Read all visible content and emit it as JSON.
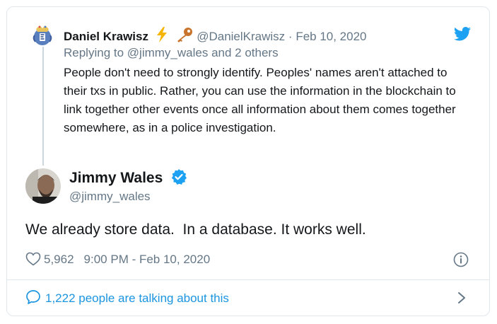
{
  "reply_tweet": {
    "author_name": "Daniel Krawisz",
    "emoji_1": "lightning-emoji",
    "emoji_2": "key-emoji",
    "handle": "@DanielKrawisz",
    "separator": "·",
    "date": "Feb 10, 2020",
    "replying_prefix": "Replying to ",
    "replying_user": "@jimmy_wales",
    "replying_suffix": " and 2 others",
    "text": "People don't need to strongly identify. Peoples' names aren't attached to their txs in public. Rather, you can use the information in the blockchain to link together other events once all information about them comes together somewhere, as in a police investigation."
  },
  "main_tweet": {
    "author_name": "Jimmy Wales",
    "handle": "@jimmy_wales",
    "text": "We already store data.  In a database. It works well.",
    "likes": "5,962",
    "timestamp": "9:00 PM - Feb 10, 2020"
  },
  "footer": {
    "talking_label": "1,222 people are talking about this"
  },
  "colors": {
    "twitter_blue": "#1da1f2",
    "link_blue": "#1b95e0",
    "muted_gray": "#657786",
    "text_dark": "#14171a",
    "border": "#e1e8ed"
  },
  "icons": {
    "brand": "twitter-bird-icon",
    "verified": "verified-badge-icon",
    "like": "heart-outline-icon",
    "info": "info-circle-icon",
    "comments": "speech-bubble-icon",
    "expand": "chevron-right-icon"
  }
}
